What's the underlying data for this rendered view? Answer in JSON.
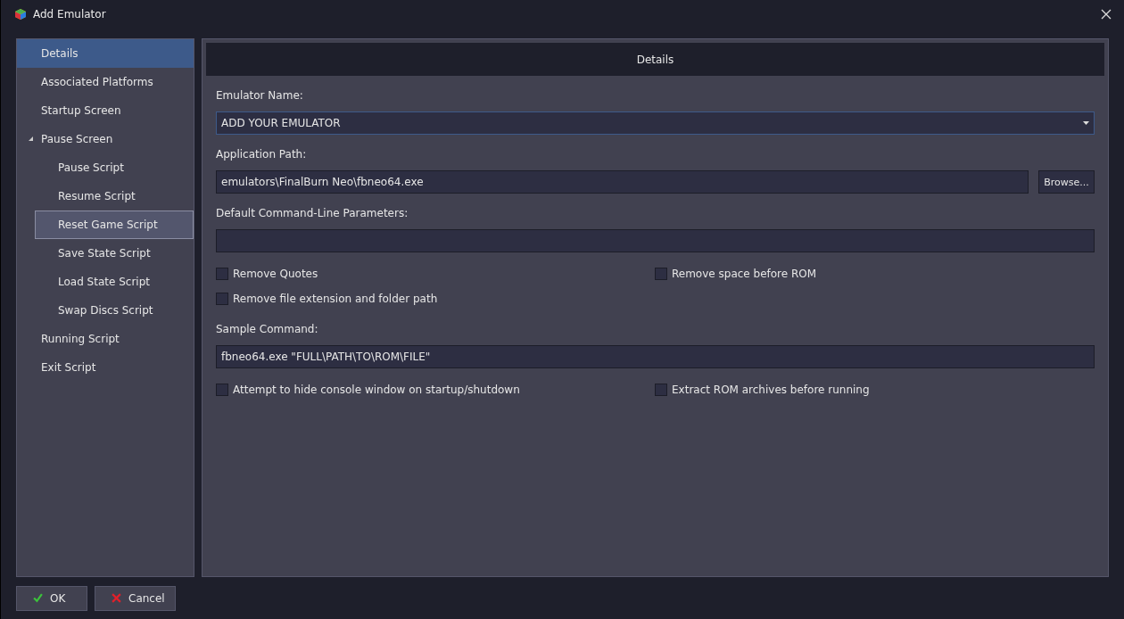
{
  "window": {
    "title": "Add Emulator"
  },
  "sidebar": {
    "items": [
      {
        "label": "Details",
        "selected": true,
        "focused": false
      },
      {
        "label": "Associated Platforms",
        "selected": false,
        "focused": false
      },
      {
        "label": "Startup Screen",
        "selected": false,
        "focused": false
      },
      {
        "label": "Pause Screen",
        "selected": false,
        "focused": false,
        "expanded": true,
        "children": [
          {
            "label": "Pause Script",
            "selected": false,
            "focused": false
          },
          {
            "label": "Resume Script",
            "selected": false,
            "focused": false
          },
          {
            "label": "Reset Game Script",
            "selected": false,
            "focused": true
          },
          {
            "label": "Save State Script",
            "selected": false,
            "focused": false
          },
          {
            "label": "Load State Script",
            "selected": false,
            "focused": false
          },
          {
            "label": "Swap Discs Script",
            "selected": false,
            "focused": false
          }
        ]
      },
      {
        "label": "Running Script",
        "selected": false,
        "focused": false
      },
      {
        "label": "Exit Script",
        "selected": false,
        "focused": false
      }
    ]
  },
  "panel": {
    "title": "Details",
    "fields": [
      {
        "kind": "combo",
        "label": "Emulator Name:",
        "value": "ADD YOUR EMULATOR",
        "focused": true
      },
      {
        "kind": "browse",
        "label": "Application Path:",
        "value": "emulators\\FinalBurn Neo\\fbneo64.exe",
        "button": "Browse..."
      },
      {
        "kind": "text",
        "label": "Default Command-Line Parameters:"
      },
      {
        "kind": "checks",
        "items": [
          {
            "label": "Remove Quotes",
            "checked": false
          },
          {
            "label": "Remove space before ROM",
            "checked": false
          },
          {
            "label": "Remove file extension and folder path",
            "checked": false
          }
        ]
      },
      {
        "kind": "text",
        "label": "Sample Command:",
        "value": "fbneo64.exe \"FULL\\PATH\\TO\\ROM\\FILE\""
      },
      {
        "kind": "checks",
        "items": [
          {
            "label": "Attempt to hide console window on startup/shutdown",
            "checked": false
          },
          {
            "label": "Extract ROM archives before running",
            "checked": false
          }
        ]
      }
    ]
  },
  "buttons": [
    {
      "kind": "ok",
      "label": "OK"
    },
    {
      "kind": "cancel",
      "label": "Cancel"
    }
  ]
}
